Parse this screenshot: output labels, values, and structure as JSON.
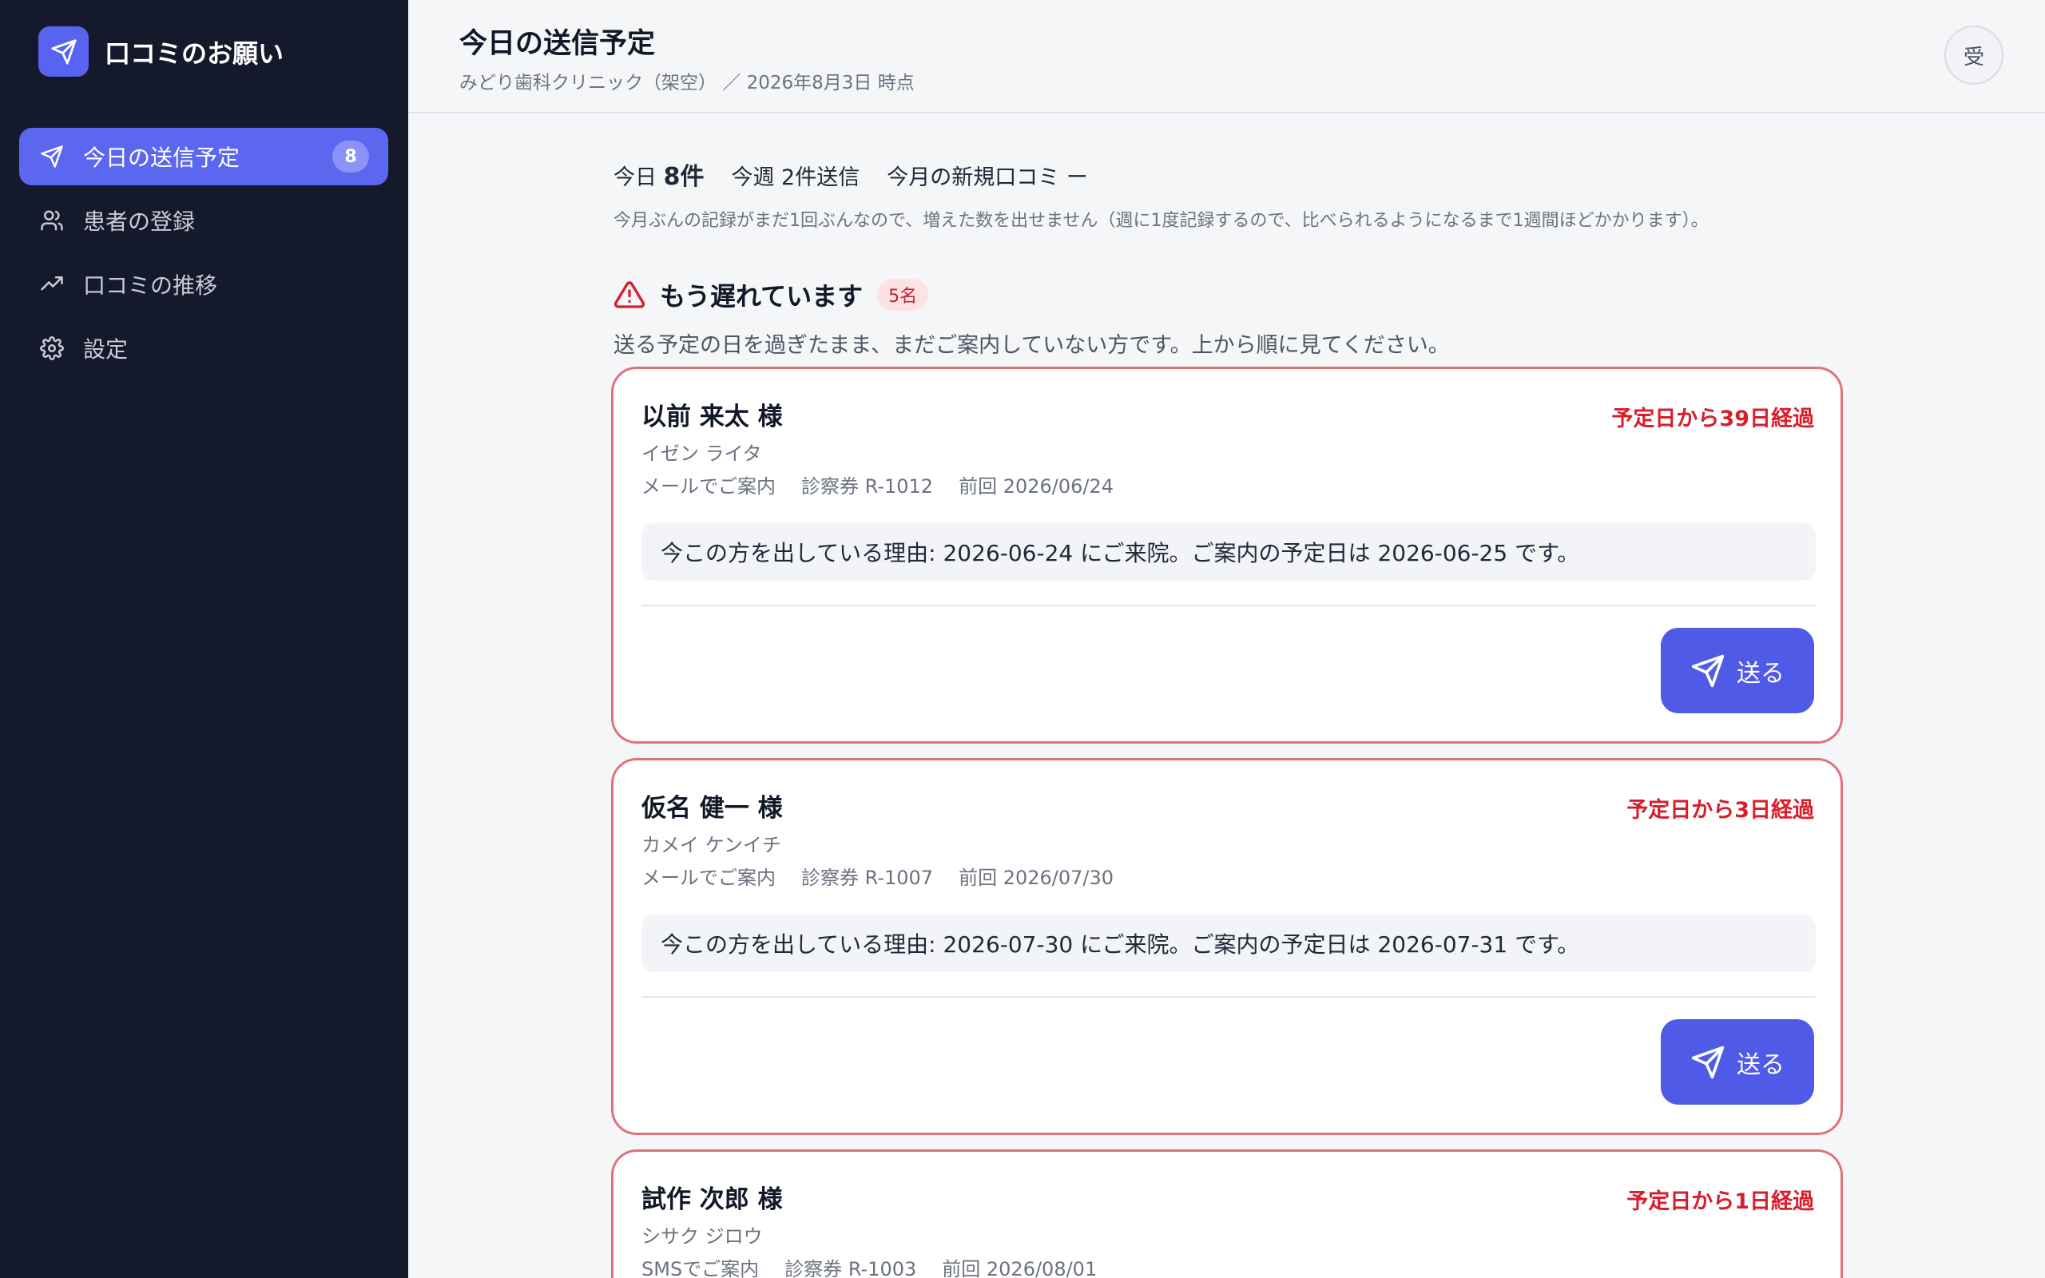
{
  "app": {
    "title": "口コミのお願い"
  },
  "sidebar": {
    "items": [
      {
        "label": "今日の送信予定",
        "badge": "8",
        "icon": "send-icon",
        "active": true
      },
      {
        "label": "患者の登録",
        "icon": "users-icon"
      },
      {
        "label": "口コミの推移",
        "icon": "trend-icon"
      },
      {
        "label": "設定",
        "icon": "gear-icon"
      }
    ]
  },
  "header": {
    "title": "今日の送信予定",
    "subtitle": "みどり歯科クリニック（架空） ／ 2026年8月3日 時点",
    "avatar": "受"
  },
  "stats": {
    "today_prefix": "今日 ",
    "today_count": "8件",
    "week": "今週 2件送信",
    "month": "今月の新規口コミ ー",
    "note": "今月ぶんの記録がまだ1回ぶんなので、増えた数を出せません（週に1度記録するので、比べられるようになるまで1週間ほどかかります）。"
  },
  "overdue": {
    "title": "もう遅れています",
    "count": "5名",
    "description": "送る予定の日を過ぎたまま、まだご案内していない方です。上から順に見てください。"
  },
  "cards": [
    {
      "name": "以前 来太 様",
      "kana": "イゼン ライタ",
      "channel": "メールでご案内",
      "ticket": "診察券 R-1012",
      "last": "前回 2026/06/24",
      "overdue": "予定日から39日経過",
      "reason": "今この方を出している理由: 2026-06-24 にご来院。ご案内の予定日は 2026-06-25 です。",
      "button": "送る"
    },
    {
      "name": "仮名 健一 様",
      "kana": "カメイ ケンイチ",
      "channel": "メールでご案内",
      "ticket": "診察券 R-1007",
      "last": "前回 2026/07/30",
      "overdue": "予定日から3日経過",
      "reason": "今この方を出している理由: 2026-07-30 にご来院。ご案内の予定日は 2026-07-31 です。",
      "button": "送る"
    },
    {
      "name": "試作 次郎 様",
      "kana": "シサク ジロウ",
      "channel": "SMSでご案内",
      "ticket": "診察券 R-1003",
      "last": "前回 2026/08/01",
      "overdue": "予定日から1日経過"
    }
  ],
  "colors": {
    "sidebar_bg": "#141a2b",
    "accent": "#5a67ee",
    "button": "#4f5ae6",
    "danger": "#d81e2c",
    "card_border": "#e0727e"
  }
}
